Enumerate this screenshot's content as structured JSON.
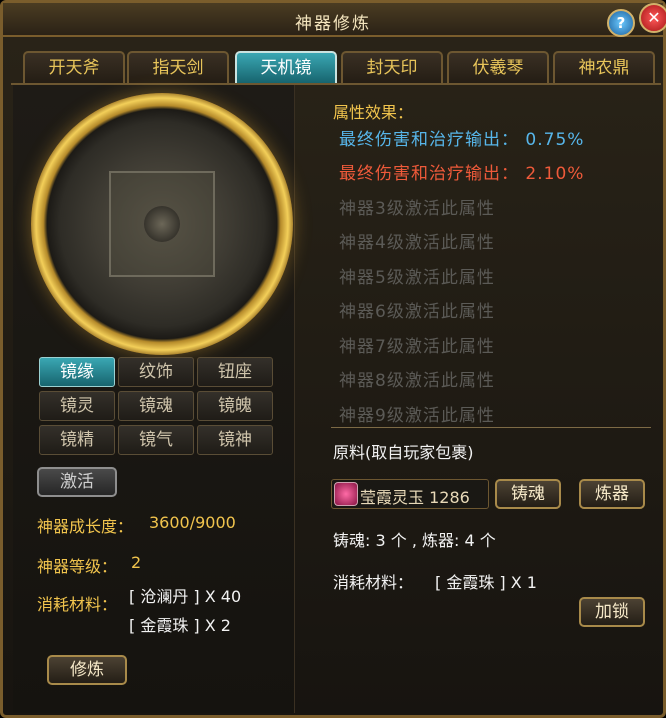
{
  "window": {
    "title": "神器修炼"
  },
  "titlebar": {
    "help_icon": "?",
    "close_icon": "✕"
  },
  "tabs": [
    {
      "label": "开天斧"
    },
    {
      "label": "指天剑"
    },
    {
      "label": "天机镜"
    },
    {
      "label": "封天印"
    },
    {
      "label": "伏羲琴"
    },
    {
      "label": "神农鼎"
    }
  ],
  "active_tab": "天机镜",
  "sub_buttons": [
    {
      "label": "镜缘"
    },
    {
      "label": "纹饰"
    },
    {
      "label": "钮座"
    },
    {
      "label": "镜灵"
    },
    {
      "label": "镜魂"
    },
    {
      "label": "镜魄"
    },
    {
      "label": "镜精"
    },
    {
      "label": "镜气"
    },
    {
      "label": "镜神"
    }
  ],
  "left": {
    "activate_label": "激活",
    "growth_label": "神器成长度：",
    "growth_value": "3600/9000",
    "level_label": "神器等级：",
    "level_value": "2",
    "consume_label": "消耗材料：",
    "consume_items": [
      "[ 沧澜丹 ] X 40",
      "[ 金霞珠 ] X 2"
    ],
    "refine_label": "修炼"
  },
  "attributes": {
    "heading": "属性效果：",
    "current": "最终伤害和治疗输出：  0.75%",
    "next": "最终伤害和治疗输出：  2.10%",
    "locked": [
      "神器3级激活此属性",
      "神器4级激活此属性",
      "神器5级激活此属性",
      "神器6级激活此属性",
      "神器7级激活此属性",
      "神器8级激活此属性",
      "神器9级激活此属性"
    ]
  },
  "materials": {
    "heading": "原料(取自玩家包裹)",
    "item_name": "莹霞灵玉 1286",
    "forge_button": "铸魂",
    "refine_button": "炼器",
    "counts": "铸魂: 3 个 , 炼器: 4 个",
    "consume_label": "消耗材料：",
    "consume_item": "[ 金霞珠 ] X 1",
    "lock_button": "加锁"
  },
  "colors": {
    "gold": "#f1c44d",
    "teal_active": "#3aa7b3",
    "blue_attr": "#57b6ea",
    "red_attr": "#ef5a3a"
  }
}
